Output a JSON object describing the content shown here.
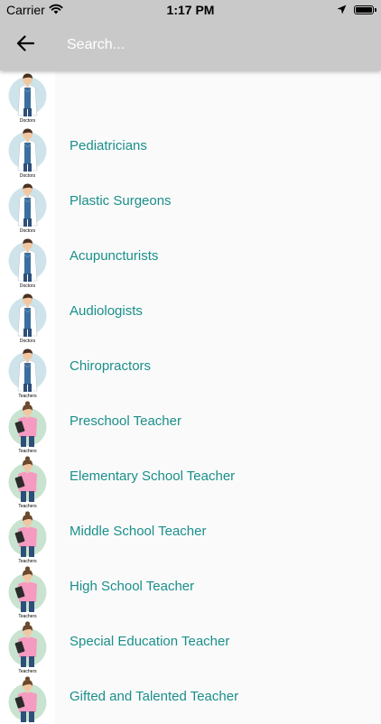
{
  "status_bar": {
    "carrier": "Carrier",
    "time": "1:17 PM",
    "wifi_icon": "wifi-icon",
    "location_icon": "location-arrow-icon",
    "battery_icon": "battery-icon",
    "battery_level": 1.0
  },
  "app_bar": {
    "back_icon": "arrow-left-icon",
    "search_placeholder": "Search...",
    "search_value": "",
    "background": "#c9c9c9"
  },
  "accent_color": "#1a8f8a",
  "list": {
    "items": [
      {
        "label": "",
        "category": "Doctors"
      },
      {
        "label": "Pediatricians",
        "category": "Doctors"
      },
      {
        "label": "Plastic Surgeons",
        "category": "Doctors"
      },
      {
        "label": "Acupuncturists",
        "category": "Doctors"
      },
      {
        "label": "Audiologists",
        "category": "Doctors"
      },
      {
        "label": "Chiropractors",
        "category": "Doctors"
      },
      {
        "label": "Preschool Teacher",
        "category": "Teachers"
      },
      {
        "label": "Elementary School Teacher",
        "category": "Teachers"
      },
      {
        "label": "Middle School Teacher",
        "category": "Teachers"
      },
      {
        "label": "High School Teacher",
        "category": "Teachers"
      },
      {
        "label": "Special Education Teacher",
        "category": "Teachers"
      },
      {
        "label": "Gifted and Talented Teacher",
        "category": "Teachers"
      }
    ]
  }
}
